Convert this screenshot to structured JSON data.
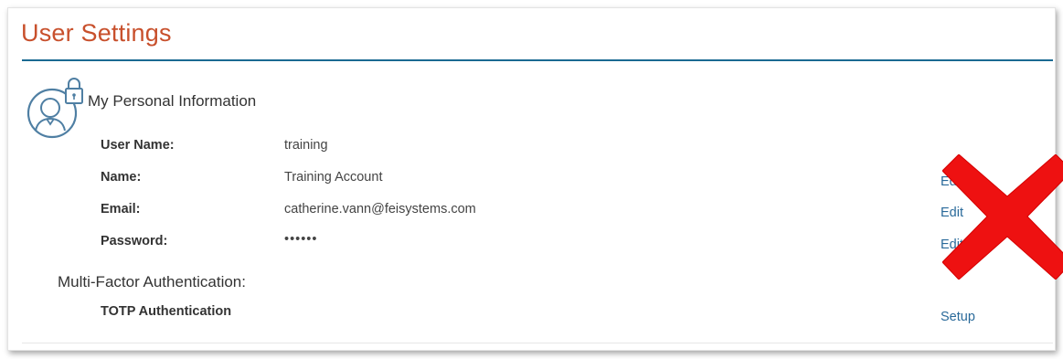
{
  "page": {
    "title": "User Settings"
  },
  "personal": {
    "section_title": "My Personal Information",
    "rows": [
      {
        "label": "User Name:",
        "value": "training",
        "action": ""
      },
      {
        "label": "Name:",
        "value": "Training Account",
        "action": "Edit"
      },
      {
        "label": "Email:",
        "value": "catherine.vann@feisystems.com",
        "action": "Edit"
      },
      {
        "label": "Password:",
        "value": "••••••",
        "action": "Edit"
      }
    ]
  },
  "mfa": {
    "section_title": "Multi-Factor Authentication:",
    "rows": [
      {
        "label": "TOTP Authentication",
        "action": "Setup"
      }
    ]
  },
  "icons": {
    "avatar": "user-lock-icon",
    "overlay": "red-x-icon"
  },
  "colors": {
    "title": "#c8502c",
    "rule": "#1a6a92",
    "link": "#2a6a9a",
    "overlay": "#ee1111"
  }
}
